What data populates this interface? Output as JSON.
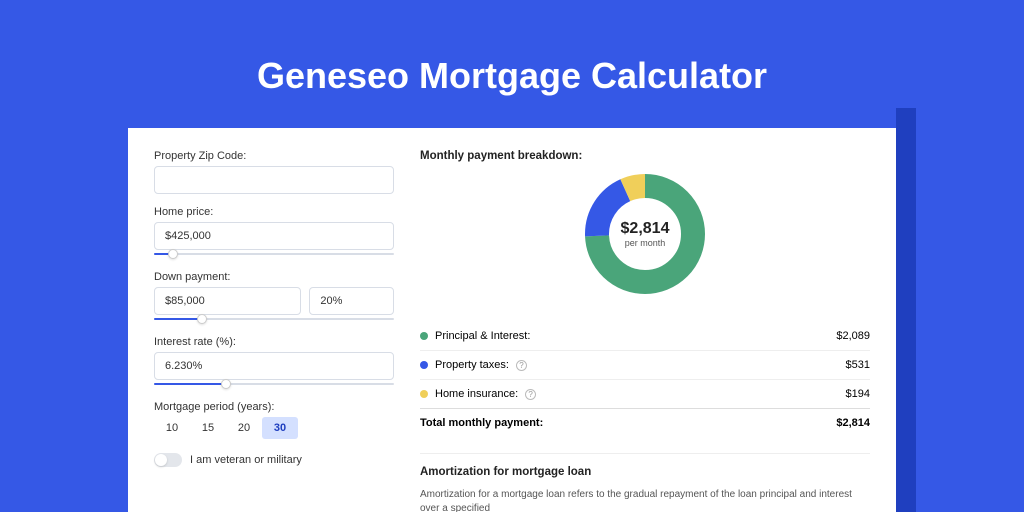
{
  "title": "Geneseo Mortgage Calculator",
  "colors": {
    "green": "#4aa57a",
    "blue": "#3558e6",
    "yellow": "#f0cf5a"
  },
  "left": {
    "zip": {
      "label": "Property Zip Code:",
      "value": ""
    },
    "home_price": {
      "label": "Home price:",
      "value": "$425,000",
      "slider_pct": 8
    },
    "down_payment": {
      "label": "Down payment:",
      "value": "$85,000",
      "pct": "20%",
      "slider_pct": 20
    },
    "interest_rate": {
      "label": "Interest rate (%):",
      "value": "6.230%",
      "slider_pct": 30
    },
    "mortgage_period": {
      "label": "Mortgage period (years):",
      "options": [
        "10",
        "15",
        "20",
        "30"
      ],
      "selected": "30"
    },
    "veteran": {
      "label": "I am veteran or military",
      "on": false
    }
  },
  "right": {
    "breakdown_title": "Monthly payment breakdown:",
    "donut": {
      "value": "$2,814",
      "sub": "per month"
    },
    "items": [
      {
        "label": "Principal & Interest:",
        "value": "$2,089",
        "color": "green",
        "help": false
      },
      {
        "label": "Property taxes:",
        "value": "$531",
        "color": "blue",
        "help": true
      },
      {
        "label": "Home insurance:",
        "value": "$194",
        "color": "yellow",
        "help": true
      }
    ],
    "total": {
      "label": "Total monthly payment:",
      "value": "$2,814"
    },
    "amort_title": "Amortization for mortgage loan",
    "amort_text": "Amortization for a mortgage loan refers to the gradual repayment of the loan principal and interest over a specified"
  },
  "chart_data": {
    "type": "pie",
    "title": "Monthly payment breakdown",
    "series": [
      {
        "name": "Principal & Interest",
        "value": 2089,
        "color": "#4aa57a"
      },
      {
        "name": "Property taxes",
        "value": 531,
        "color": "#3558e6"
      },
      {
        "name": "Home insurance",
        "value": 194,
        "color": "#f0cf5a"
      }
    ],
    "total": 2814,
    "center_label": "$2,814 per month"
  }
}
